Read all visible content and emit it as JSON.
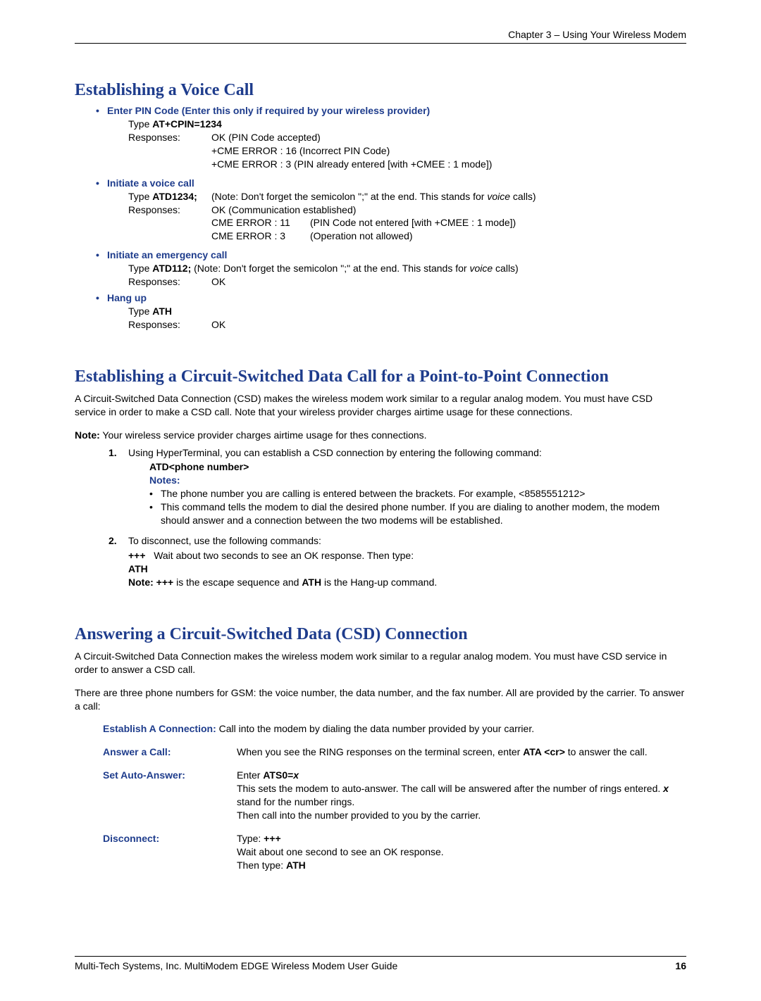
{
  "header": {
    "chapter": "Chapter 3 – Using Your Wireless Modem"
  },
  "section1": {
    "title": "Establishing a Voice Call",
    "b1": {
      "head": "Enter PIN Code (Enter this only if required by your wireless provider)",
      "type_pre": "Type ",
      "type_cmd": "AT+CPIN=1234",
      "resp_label": "Responses:",
      "r1": "OK  (PIN Code accepted)",
      "r2": "+CME ERROR : 16 (Incorrect PIN Code)",
      "r3": "+CME ERROR : 3 (PIN already entered [with +CMEE : 1 mode])"
    },
    "b2": {
      "head": "Initiate a voice call",
      "type_pre": "Type ",
      "type_cmd": "ATD1234;",
      "note_a": "(Note: Don't forget the semicolon \";\" at the end. This stands for ",
      "note_b": "voice",
      "note_c": " calls)",
      "resp_label": "Responses:",
      "r1": "OK (Communication established)",
      "r2": "CME ERROR : 11",
      "r2b": "(PIN Code not entered [with +CMEE : 1 mode])",
      "r3": "CME ERROR : 3",
      "r3b": "(Operation not allowed)"
    },
    "b3": {
      "head": "Initiate an emergency call",
      "type_pre": "Type ",
      "type_cmd": "ATD112;",
      "note_a": " (Note: Don't forget the semicolon \";\" at the end. This stands for ",
      "note_b": "voice",
      "note_c": " calls)",
      "resp_label": "Responses:",
      "r1": "OK"
    },
    "b4": {
      "head": "Hang up",
      "type_pre": "Type ",
      "type_cmd": "ATH",
      "resp_label": "Responses:",
      "r1": "OK"
    }
  },
  "section2": {
    "title": "Establishing a Circuit-Switched Data Call for a Point-to-Point Connection",
    "para": "A Circuit-Switched Data Connection (CSD) makes the wireless modem work similar to a regular analog modem. You must have CSD service in order to make a CSD call. Note that your wireless provider charges airtime usage for these connections.",
    "note_pre": "Note:",
    "note_body": " Your wireless service provider charges airtime usage for thes connections.",
    "n1": {
      "num": "1.",
      "text": "Using HyperTerminal, you can establish a CSD connection by entering the following command:",
      "cmd": "ATD<phone number>",
      "notes_label": "Notes:",
      "sb1": "The phone number you are calling is entered between the brackets. For example, <8585551212>",
      "sb2": "This command tells the modem to dial the desired phone number. If you are dialing to another modem, the modem should answer and a connection between the two modems will be established."
    },
    "n2": {
      "num": "2.",
      "text": "To disconnect, use the following commands:",
      "plus": "+++",
      "plus_text": "Wait about two seconds to see an OK response. Then type:",
      "ath": "ATH",
      "note_pre": "Note: ",
      "note_a": "+++",
      "note_mid": " is the escape sequence and ",
      "note_b": "ATH",
      "note_end": " is the Hang-up command."
    }
  },
  "section3": {
    "title": "Answering a Circuit-Switched Data (CSD) Connection",
    "para1": "A Circuit-Switched Data Connection makes the wireless modem work similar to a regular analog modem. You must have CSD service in order to answer a CSD call.",
    "para2": "There are three phone numbers for GSM: the voice number, the data number, and the fax number. All are provided by the carrier. To answer a call:",
    "rows": {
      "r1": {
        "label": "Establish A Connection:",
        "body": " Call into the modem by dialing the data number provided by your carrier."
      },
      "r2": {
        "label": "Answer a Call:",
        "a": "When you see the RING responses on the terminal screen, enter ",
        "b": "ATA <cr>",
        "c": " to answer the call."
      },
      "r3": {
        "label": "Set Auto-Answer:",
        "a": "Enter ",
        "b": "ATS0=",
        "b2": "x",
        "c": "This sets the modem to auto-answer. The call will be answered after the number of rings entered.  ",
        "c2": "x",
        "c3": " stand for the number rings.",
        "d": "Then call into the number provided to you by the carrier."
      },
      "r4": {
        "label": "Disconnect:",
        "a": "Type: ",
        "b": "+++",
        "c": "Wait about one second to see an OK response.",
        "d": "Then type: ",
        "e": "ATH"
      }
    }
  },
  "footer": {
    "text": "Multi-Tech Systems, Inc. MultiModem EDGE Wireless Modem User Guide",
    "page": "16"
  }
}
